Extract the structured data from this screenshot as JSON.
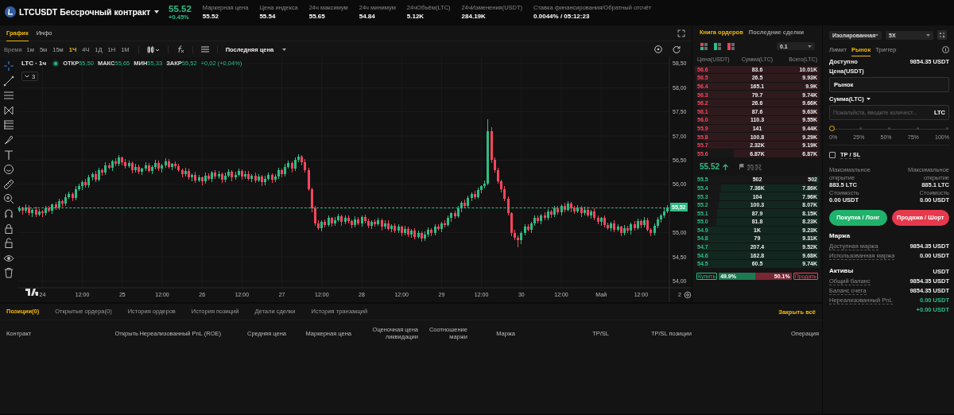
{
  "header": {
    "symbol": "LTCUSDT Бессрочный контракт",
    "last_price": "55.52",
    "change": "+0.45%",
    "stats": [
      {
        "label": "Маркерная цена",
        "value": "55.52"
      },
      {
        "label": "Цена индекса",
        "value": "55.54"
      },
      {
        "label": "24ч максимум",
        "value": "55.65"
      },
      {
        "label": "24ч минимум",
        "value": "54.84"
      },
      {
        "label": "24чОбъём(LTC)",
        "value": "5.12K"
      },
      {
        "label": "24чИзменения(USDT)",
        "value": "284.19K"
      },
      {
        "label": "Ставка финансирования/Обратный отсчёт",
        "value": "0.0044% / 05:12:23"
      }
    ]
  },
  "chart": {
    "tabs": [
      {
        "label": "График",
        "selected": true
      },
      {
        "label": "Инфо",
        "selected": false
      }
    ],
    "time_label": "Время",
    "intervals": [
      {
        "label": "1м",
        "selected": false
      },
      {
        "label": "5м",
        "selected": false
      },
      {
        "label": "15м",
        "selected": false
      },
      {
        "label": "1Ч",
        "selected": true
      },
      {
        "label": "4Ч",
        "selected": false
      },
      {
        "label": "1Д",
        "selected": false
      },
      {
        "label": "1Н",
        "selected": false
      },
      {
        "label": "1М",
        "selected": false
      }
    ],
    "price_source": "Последняя цена",
    "legend": {
      "title": "LTC · 1ч",
      "values": [
        {
          "label": "ОТКР",
          "value": "55,50"
        },
        {
          "label": "МАКС",
          "value": "55,65"
        },
        {
          "label": "МИН",
          "value": "55,33"
        },
        {
          "label": "ЗАКР",
          "value": "55,52"
        }
      ],
      "change": "+0,02 (+0,04%)",
      "indicators": "3"
    },
    "current_price": "55,52",
    "time_axis": [
      "24",
      "12:00",
      "25",
      "12:00",
      "26",
      "12:00",
      "27",
      "12:00",
      "28",
      "12:00",
      "29",
      "12:00",
      "30",
      "12:00",
      "Май",
      "12:00",
      "2"
    ],
    "chart_data": {
      "type": "candlestick",
      "categories": [
        null,
        null,
        null,
        null,
        null,
        null,
        null,
        null,
        null,
        null,
        null,
        null,
        null,
        null,
        null,
        null,
        null,
        null,
        null,
        null,
        null,
        null,
        null,
        null,
        null,
        null,
        null,
        null,
        null,
        null,
        null,
        null,
        null,
        null,
        null,
        null,
        null,
        null,
        null,
        null,
        null,
        null,
        null,
        null,
        null,
        null,
        null,
        null,
        null,
        null,
        null,
        null,
        null,
        null,
        null,
        null,
        null,
        null,
        null,
        null,
        null,
        null,
        null,
        null,
        null,
        null,
        null,
        null,
        null,
        null,
        null,
        null,
        null,
        null,
        null,
        null,
        null,
        null,
        null,
        null,
        null,
        null,
        null,
        null,
        null,
        null,
        null,
        null,
        null,
        null,
        null,
        null,
        null,
        null,
        null,
        null,
        null,
        null,
        null,
        null,
        null,
        null,
        null,
        null,
        null,
        null,
        null,
        null,
        null,
        null,
        null,
        null,
        null,
        null,
        null,
        null,
        null,
        null,
        null,
        null,
        null,
        null,
        null,
        null,
        null,
        null,
        null,
        null,
        null,
        null,
        null,
        null,
        null,
        null,
        null,
        null,
        null,
        null,
        null,
        null,
        null,
        null,
        null,
        null,
        null,
        null,
        null,
        null,
        null,
        null,
        null,
        null,
        null,
        null,
        null,
        null,
        null,
        null,
        null,
        null,
        null,
        null,
        null,
        null,
        null,
        null,
        null,
        null,
        null,
        null,
        null,
        null,
        null,
        null,
        null,
        null,
        null,
        null,
        null,
        null,
        null,
        null,
        null,
        null,
        null,
        null,
        null,
        null,
        null,
        null,
        null,
        null,
        null,
        null,
        null,
        null
      ],
      "ohlc": [
        [
          55.46,
          55.55,
          55.42,
          55.5
        ],
        [
          55.5,
          55.53,
          55.38,
          55.45
        ],
        [
          55.45,
          55.58,
          55.4,
          55.52
        ],
        [
          55.52,
          55.57,
          55.36,
          55.4
        ],
        [
          55.4,
          55.51,
          55.33,
          55.48
        ],
        [
          55.48,
          55.54,
          55.33,
          55.38
        ],
        [
          55.38,
          55.49,
          55.34,
          55.44
        ],
        [
          55.44,
          55.47,
          55.33,
          55.4
        ],
        [
          55.4,
          55.56,
          55.35,
          55.5
        ],
        [
          55.5,
          55.55,
          55.42,
          55.46
        ],
        [
          55.46,
          55.61,
          55.39,
          55.58
        ],
        [
          55.58,
          55.64,
          55.47,
          55.52
        ],
        [
          55.52,
          55.71,
          55.48,
          55.66
        ],
        [
          55.66,
          55.69,
          55.53,
          55.6
        ],
        [
          55.6,
          55.8,
          55.55,
          55.74
        ],
        [
          55.74,
          55.85,
          55.7,
          55.8
        ],
        [
          55.8,
          55.83,
          55.65,
          55.72
        ],
        [
          55.72,
          55.96,
          55.67,
          55.9
        ],
        [
          55.9,
          56.01,
          55.86,
          55.96
        ],
        [
          55.96,
          56.08,
          55.89,
          56.05
        ],
        [
          56.05,
          56.11,
          55.93,
          55.98
        ],
        [
          55.98,
          56.2,
          55.94,
          56.15
        ],
        [
          56.15,
          56.25,
          56.08,
          56.22
        ],
        [
          56.22,
          56.28,
          56.05,
          56.1
        ],
        [
          56.1,
          56.35,
          56.06,
          56.3
        ],
        [
          56.3,
          56.33,
          56.18,
          56.25
        ],
        [
          56.25,
          56.46,
          56.2,
          56.4
        ],
        [
          56.4,
          56.45,
          56.31,
          56.35
        ],
        [
          56.35,
          56.51,
          56.28,
          56.48
        ],
        [
          56.48,
          56.54,
          56.37,
          56.42
        ],
        [
          56.42,
          56.6,
          56.38,
          56.55
        ],
        [
          56.55,
          56.58,
          56.39,
          56.46
        ],
        [
          56.46,
          56.52,
          56.33,
          56.38
        ],
        [
          56.38,
          56.49,
          56.34,
          56.44
        ],
        [
          56.44,
          56.47,
          56.23,
          56.3
        ],
        [
          56.3,
          56.42,
          56.25,
          56.36
        ],
        [
          56.36,
          56.41,
          56.22,
          56.26
        ],
        [
          56.26,
          56.35,
          56.19,
          56.32
        ],
        [
          56.32,
          56.46,
          56.27,
          56.4
        ],
        [
          56.4,
          56.45,
          56.24,
          56.28
        ],
        [
          56.28,
          56.39,
          56.21,
          56.36
        ],
        [
          56.36,
          56.5,
          56.31,
          56.44
        ],
        [
          56.44,
          56.49,
          56.28,
          56.32
        ],
        [
          56.32,
          56.43,
          56.25,
          56.4
        ],
        [
          56.4,
          56.54,
          56.35,
          56.48
        ],
        [
          56.48,
          56.53,
          56.32,
          56.36
        ],
        [
          56.36,
          56.45,
          56.29,
          56.42
        ],
        [
          56.42,
          56.48,
          56.33,
          56.38
        ],
        [
          56.38,
          56.43,
          56.26,
          56.3
        ],
        [
          56.3,
          56.33,
          56.15,
          56.22
        ],
        [
          56.22,
          56.34,
          56.17,
          56.28
        ],
        [
          56.28,
          56.33,
          56.1,
          56.14
        ],
        [
          56.14,
          56.23,
          56.07,
          56.2
        ],
        [
          56.2,
          56.26,
          56.03,
          56.08
        ],
        [
          56.08,
          56.19,
          56.04,
          56.14
        ],
        [
          56.14,
          56.17,
          55.99,
          56.06
        ],
        [
          56.06,
          56.24,
          56.01,
          56.18
        ],
        [
          56.18,
          56.23,
          56.08,
          56.12
        ],
        [
          56.12,
          56.27,
          56.05,
          56.24
        ],
        [
          56.24,
          56.3,
          56.11,
          56.16
        ],
        [
          56.16,
          56.27,
          56.12,
          56.22
        ],
        [
          56.22,
          56.25,
          56.03,
          56.1
        ],
        [
          56.1,
          56.24,
          56.05,
          56.18
        ],
        [
          56.18,
          56.31,
          56.14,
          56.26
        ],
        [
          56.26,
          56.29,
          56.07,
          56.14
        ],
        [
          56.14,
          56.26,
          56.09,
          56.2
        ],
        [
          56.2,
          56.33,
          56.16,
          56.28
        ],
        [
          56.28,
          56.31,
          56.09,
          56.16
        ],
        [
          56.16,
          56.28,
          56.11,
          56.22
        ],
        [
          56.22,
          56.27,
          56.08,
          56.12
        ],
        [
          56.12,
          56.21,
          56.05,
          56.18
        ],
        [
          56.18,
          56.24,
          56.03,
          56.08
        ],
        [
          56.08,
          56.21,
          56.04,
          56.16
        ],
        [
          56.16,
          56.19,
          55.97,
          56.04
        ],
        [
          56.04,
          56.18,
          55.99,
          56.12
        ],
        [
          56.12,
          56.25,
          56.08,
          56.2
        ],
        [
          56.2,
          56.23,
          56.03,
          56.1
        ],
        [
          56.1,
          56.22,
          56.05,
          56.16
        ],
        [
          56.16,
          56.35,
          56.12,
          56.3
        ],
        [
          56.3,
          56.33,
          56.15,
          56.22
        ],
        [
          56.22,
          56.42,
          56.17,
          56.36
        ],
        [
          56.36,
          56.49,
          56.32,
          56.44
        ],
        [
          56.44,
          56.47,
          56.25,
          56.32
        ],
        [
          56.32,
          56.56,
          56.27,
          56.5
        ],
        [
          56.5,
          56.63,
          56.46,
          56.58
        ],
        [
          56.58,
          56.61,
          56.39,
          56.46
        ],
        [
          56.46,
          56.52,
          56.25,
          56.3
        ],
        [
          56.3,
          56.35,
          55.86,
          55.9
        ],
        [
          55.9,
          55.93,
          55.43,
          55.5
        ],
        [
          55.5,
          55.56,
          55.15,
          55.2
        ],
        [
          55.2,
          55.25,
          55.06,
          55.1
        ],
        [
          55.1,
          55.25,
          55.03,
          55.22
        ],
        [
          55.22,
          55.28,
          55.11,
          55.16
        ],
        [
          55.16,
          55.35,
          55.12,
          55.3
        ],
        [
          55.3,
          55.33,
          55.13,
          55.2
        ],
        [
          55.2,
          55.32,
          55.15,
          55.26
        ],
        [
          55.26,
          55.39,
          55.22,
          55.34
        ],
        [
          55.34,
          55.37,
          55.15,
          55.22
        ],
        [
          55.22,
          55.36,
          55.17,
          55.3
        ],
        [
          55.3,
          55.35,
          55.2,
          55.24
        ],
        [
          55.24,
          55.27,
          55.09,
          55.16
        ],
        [
          55.16,
          55.34,
          55.11,
          55.28
        ],
        [
          55.28,
          55.33,
          55.16,
          55.2
        ],
        [
          55.2,
          55.35,
          55.13,
          55.32
        ],
        [
          55.32,
          55.38,
          55.19,
          55.24
        ],
        [
          55.24,
          55.29,
          55.1,
          55.14
        ],
        [
          55.14,
          55.25,
          55.07,
          55.22
        ],
        [
          55.22,
          55.28,
          55.13,
          55.18
        ],
        [
          55.18,
          55.31,
          55.14,
          55.26
        ],
        [
          55.26,
          55.29,
          55.05,
          55.12
        ],
        [
          55.12,
          55.26,
          55.07,
          55.2
        ],
        [
          55.2,
          55.25,
          55.04,
          55.08
        ],
        [
          55.08,
          55.17,
          55.01,
          55.14
        ],
        [
          55.14,
          55.2,
          54.99,
          55.04
        ],
        [
          55.04,
          55.17,
          55.0,
          55.12
        ],
        [
          55.12,
          55.15,
          54.93,
          55.0
        ],
        [
          55.0,
          55.14,
          54.95,
          55.08
        ],
        [
          55.08,
          55.13,
          54.92,
          54.96
        ],
        [
          54.96,
          55.07,
          54.89,
          55.04
        ],
        [
          55.04,
          55.1,
          54.87,
          54.92
        ],
        [
          54.92,
          55.05,
          54.88,
          55.0
        ],
        [
          55.0,
          55.03,
          54.81,
          54.88
        ],
        [
          54.88,
          55.02,
          54.83,
          54.96
        ],
        [
          54.96,
          55.11,
          54.92,
          55.06
        ],
        [
          55.06,
          55.09,
          54.93,
          55.0
        ],
        [
          55.0,
          55.18,
          54.95,
          55.12
        ],
        [
          55.12,
          55.17,
          55.04,
          55.08
        ],
        [
          55.08,
          55.23,
          55.01,
          55.2
        ],
        [
          55.2,
          55.26,
          55.11,
          55.16
        ],
        [
          55.16,
          55.35,
          55.12,
          55.3
        ],
        [
          55.3,
          55.43,
          55.23,
          55.4
        ],
        [
          55.4,
          55.46,
          55.29,
          55.34
        ],
        [
          55.34,
          55.55,
          55.3,
          55.5
        ],
        [
          55.5,
          55.65,
          55.43,
          55.62
        ],
        [
          55.62,
          55.68,
          55.51,
          55.56
        ],
        [
          55.56,
          55.77,
          55.52,
          55.72
        ],
        [
          55.72,
          55.83,
          55.65,
          55.8
        ],
        [
          55.8,
          55.86,
          55.69,
          55.74
        ],
        [
          55.74,
          55.93,
          55.7,
          55.88
        ],
        [
          55.88,
          55.99,
          55.81,
          55.96
        ],
        [
          55.96,
          56.08,
          55.91,
          56.02
        ],
        [
          56.02,
          57.34,
          55.98,
          57.1
        ],
        [
          57.1,
          57.18,
          56.44,
          56.5
        ],
        [
          56.5,
          56.56,
          56.25,
          56.3
        ],
        [
          56.3,
          56.35,
          56.02,
          56.06
        ],
        [
          56.06,
          56.09,
          55.83,
          55.9
        ],
        [
          55.9,
          55.96,
          55.65,
          55.7
        ],
        [
          55.7,
          55.75,
          55.36,
          55.4
        ],
        [
          55.4,
          55.43,
          54.93,
          55.0
        ],
        [
          55.0,
          55.06,
          54.85,
          54.9
        ],
        [
          54.9,
          54.95,
          54.7,
          54.84
        ],
        [
          54.84,
          55.03,
          54.77,
          55.0
        ],
        [
          55.0,
          55.18,
          54.95,
          55.12
        ],
        [
          55.12,
          55.17,
          55.02,
          55.06
        ],
        [
          55.06,
          55.23,
          54.99,
          55.2
        ],
        [
          55.2,
          55.36,
          55.15,
          55.3
        ],
        [
          55.3,
          55.35,
          55.2,
          55.24
        ],
        [
          55.24,
          55.39,
          55.17,
          55.36
        ],
        [
          55.36,
          55.42,
          55.25,
          55.3
        ],
        [
          55.3,
          55.49,
          55.26,
          55.44
        ],
        [
          55.44,
          55.47,
          55.31,
          55.38
        ],
        [
          55.38,
          55.56,
          55.33,
          55.5
        ],
        [
          55.5,
          55.55,
          55.38,
          55.42
        ],
        [
          55.42,
          55.59,
          55.35,
          55.56
        ],
        [
          55.56,
          55.62,
          55.43,
          55.48
        ],
        [
          55.48,
          55.65,
          55.44,
          55.6
        ],
        [
          55.6,
          55.63,
          55.43,
          55.5
        ],
        [
          55.5,
          55.56,
          55.39,
          55.44
        ],
        [
          55.44,
          55.57,
          55.4,
          55.52
        ],
        [
          55.52,
          55.55,
          55.33,
          55.4
        ],
        [
          55.4,
          55.54,
          55.35,
          55.48
        ],
        [
          55.48,
          55.53,
          55.32,
          55.36
        ],
        [
          55.36,
          55.47,
          55.29,
          55.44
        ],
        [
          55.44,
          55.5,
          55.25,
          55.3
        ],
        [
          55.3,
          55.35,
          55.18,
          55.22
        ],
        [
          55.22,
          55.33,
          55.15,
          55.3
        ],
        [
          55.3,
          55.36,
          55.11,
          55.16
        ],
        [
          55.16,
          55.21,
          55.06,
          55.1
        ],
        [
          55.1,
          55.23,
          55.03,
          55.2
        ],
        [
          55.2,
          55.26,
          55.01,
          55.06
        ],
        [
          55.06,
          55.17,
          55.02,
          55.12
        ],
        [
          55.12,
          55.15,
          54.93,
          55.0
        ],
        [
          55.0,
          55.16,
          54.95,
          55.1
        ],
        [
          55.1,
          55.15,
          55.0,
          55.04
        ],
        [
          55.04,
          55.21,
          54.97,
          55.18
        ],
        [
          55.18,
          55.24,
          55.05,
          55.1
        ],
        [
          55.1,
          55.29,
          55.06,
          55.24
        ],
        [
          55.24,
          55.27,
          55.09,
          55.16
        ],
        [
          55.16,
          55.32,
          55.11,
          55.26
        ],
        [
          55.26,
          55.31,
          55.02,
          55.06
        ],
        [
          55.06,
          55.09,
          54.93,
          55.0
        ],
        [
          55.0,
          55.2,
          54.95,
          55.14
        ],
        [
          55.14,
          55.33,
          55.1,
          55.28
        ],
        [
          55.28,
          55.39,
          55.21,
          55.36
        ],
        [
          55.36,
          55.5,
          55.31,
          55.44
        ],
        [
          55.44,
          55.57,
          55.4,
          55.52
        ]
      ],
      "ylim": [
        53.86,
        58.63
      ],
      "grid": true,
      "yticks": [
        {
          "value": 58.5,
          "label": "58,50"
        },
        {
          "value": 58,
          "label": "58,00"
        },
        {
          "value": 57.5,
          "label": "57,50"
        },
        {
          "value": 57,
          "label": "57,00"
        },
        {
          "value": 56.5,
          "label": "56,50"
        },
        {
          "value": 56,
          "label": "56,00"
        },
        {
          "value": 55,
          "label": "55,00"
        },
        {
          "value": 54.5,
          "label": "54,50"
        },
        {
          "value": 54,
          "label": "54,00"
        }
      ]
    }
  },
  "order_book": {
    "tabs": [
      {
        "label": "Книга ордеров",
        "selected": true
      },
      {
        "label": "Последние сделки",
        "selected": false
      }
    ],
    "precision": "0.1",
    "columns": [
      "Цена(USDT)",
      "Сумма(LTC)",
      "Всего(LTC)"
    ],
    "asks": [
      {
        "price": "56.6",
        "amount": "83.6",
        "total": "10.01K",
        "level": 1
      },
      {
        "price": "56.5",
        "amount": "26.5",
        "total": "9.93K",
        "level": 0.99
      },
      {
        "price": "56.4",
        "amount": "165.1",
        "total": "9.9K",
        "level": 0.99
      },
      {
        "price": "56.3",
        "amount": "79.7",
        "total": "9.74K",
        "level": 0.97
      },
      {
        "price": "56.2",
        "amount": "26.6",
        "total": "9.66K",
        "level": 0.965
      },
      {
        "price": "56.1",
        "amount": "87.6",
        "total": "9.63K",
        "level": 0.96
      },
      {
        "price": "56.0",
        "amount": "110.3",
        "total": "9.55K",
        "level": 0.95
      },
      {
        "price": "55.9",
        "amount": "141",
        "total": "9.44K",
        "level": 0.94
      },
      {
        "price": "55.8",
        "amount": "100.8",
        "total": "9.29K",
        "level": 0.93
      },
      {
        "price": "55.7",
        "amount": "2.32K",
        "total": "9.19K",
        "level": 0.92
      },
      {
        "price": "55.6",
        "amount": "6.87K",
        "total": "6.87K",
        "level": 0.69
      }
    ],
    "last_price": "55.52",
    "mark_price": "55.52",
    "bids": [
      {
        "price": "55.5",
        "amount": "502",
        "total": "502",
        "level": 0.05
      },
      {
        "price": "55.4",
        "amount": "7.36K",
        "total": "7.86K",
        "level": 0.79
      },
      {
        "price": "55.3",
        "amount": "104",
        "total": "7.96K",
        "level": 0.8
      },
      {
        "price": "55.2",
        "amount": "100.3",
        "total": "8.07K",
        "level": 0.81
      },
      {
        "price": "55.1",
        "amount": "87.9",
        "total": "8.15K",
        "level": 0.82
      },
      {
        "price": "55.0",
        "amount": "81.8",
        "total": "8.23K",
        "level": 0.83
      },
      {
        "price": "54.9",
        "amount": "1K",
        "total": "9.23K",
        "level": 0.92
      },
      {
        "price": "54.8",
        "amount": "79",
        "total": "9.31K",
        "level": 0.93
      },
      {
        "price": "54.7",
        "amount": "207.4",
        "total": "9.52K",
        "level": 0.95
      },
      {
        "price": "54.6",
        "amount": "162.8",
        "total": "9.68K",
        "level": 0.97
      },
      {
        "price": "54.5",
        "amount": "60.5",
        "total": "9.74K",
        "level": 0.97
      }
    ],
    "ratio": {
      "buy_label": "Купить",
      "buy": "49.9%",
      "sell": "50.1%",
      "sell_label": "Продать",
      "level": 0.499
    }
  },
  "trade": {
    "margin_mode": "Изолированная",
    "leverage": "5X",
    "order_types": [
      {
        "label": "Лимит",
        "selected": false
      },
      {
        "label": "Рынок",
        "selected": true
      },
      {
        "label": "Триггер",
        "selected": false
      }
    ],
    "available_label": "Доступно",
    "available": "9854.35 USDT",
    "price_label": "Цена(USDT)",
    "price_value": "Рынок",
    "amount_label": "Сумма(LTC)",
    "amount_placeholder": "Пожалуйста, вводите количест...",
    "amount_unit": "LTC",
    "slider": {
      "level": 0,
      "marks": [
        "0%",
        "25%",
        "50%",
        "75%",
        "100%"
      ]
    },
    "tpsl": {
      "label": "TP / SL",
      "checked": false
    },
    "max_open": [
      {
        "label": "Максимальное открытие",
        "value": "883.5 LTC"
      },
      {
        "label": "Максимальное открытие",
        "value": "885.1 LTC"
      }
    ],
    "cost": [
      {
        "label": "Стоимость",
        "value": "0.00 USDT"
      },
      {
        "label": "Стоимость",
        "value": "0.00 USDT"
      }
    ],
    "buy_button": "Покупка / Лонг",
    "sell_button": "Продажа / Шорт",
    "margin": {
      "title": "Маржа",
      "rows": [
        {
          "label": "Доступная маржа",
          "value": "9854.35 USDT"
        },
        {
          "label": "Использованная маржа",
          "value": "0.00 USDT"
        }
      ]
    },
    "assets": {
      "title": "Активы",
      "currency": "USDT",
      "rows": [
        {
          "label": "Общий баланс",
          "value": "9854.35 USDT"
        },
        {
          "label": "Баланс счета",
          "value": "9854.35 USDT"
        },
        {
          "label": "Нереализованный PnL",
          "value": "0.00 USDT"
        }
      ],
      "extra": "+0.00 USDT"
    }
  },
  "bottom": {
    "tabs": [
      {
        "label": "Позиции(0)",
        "selected": true
      },
      {
        "label": "Открытые ордера(0)",
        "selected": false
      },
      {
        "label": "История ордеров",
        "selected": false
      },
      {
        "label": "История позиций",
        "selected": false
      },
      {
        "label": "Детали сделки",
        "selected": false
      },
      {
        "label": "История транзакций",
        "selected": false
      }
    ],
    "close_all": "Закрыть всё",
    "columns": [
      "Контракт",
      "Открыть",
      "Нереализованный PnL (ROE)",
      "Средняя цена",
      "Маркерная цена",
      "Оценочная цена ликвидации",
      "Соотношение маржи",
      "Маржа",
      "TP/SL",
      "TP/SL позиции",
      "Операция"
    ]
  }
}
